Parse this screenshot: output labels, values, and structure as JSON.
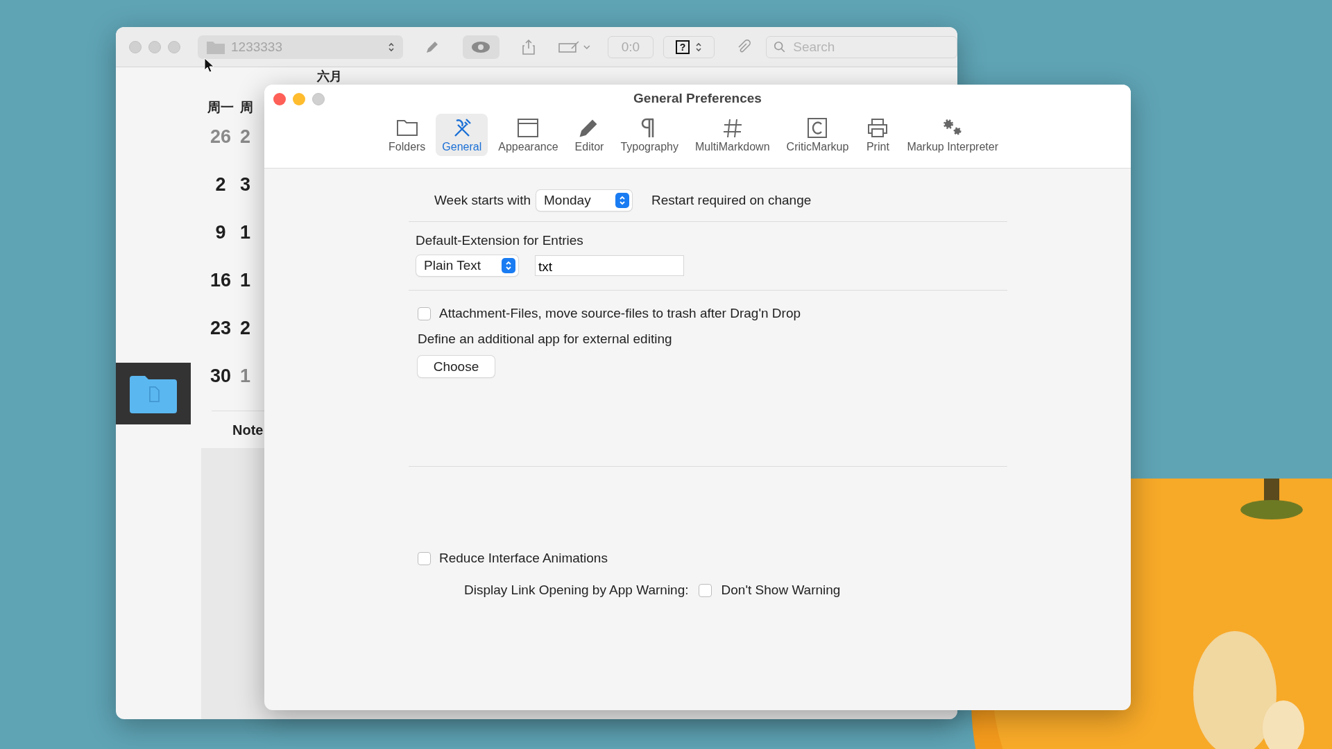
{
  "back_window": {
    "document_popup": "1233333",
    "counter": "0:0",
    "help_popup": "?",
    "search": {
      "placeholder": "Search"
    },
    "calendar": {
      "month": "六月",
      "weekdays": [
        "周一",
        "周"
      ],
      "weeks": [
        [
          {
            "day": "26",
            "other_month": true
          },
          {
            "day": "2",
            "other_month": true
          }
        ],
        [
          {
            "day": "2",
            "other_month": false
          },
          {
            "day": "3",
            "other_month": false
          }
        ],
        [
          {
            "day": "9",
            "other_month": false
          },
          {
            "day": "1",
            "other_month": false
          }
        ],
        [
          {
            "day": "16",
            "other_month": false
          },
          {
            "day": "1",
            "other_month": false
          }
        ],
        [
          {
            "day": "23",
            "other_month": false
          },
          {
            "day": "2",
            "other_month": false
          }
        ],
        [
          {
            "day": "30",
            "other_month": false
          },
          {
            "day": "1",
            "other_month": true
          }
        ]
      ]
    },
    "notes_heading": "Note"
  },
  "preferences": {
    "title": "General Preferences",
    "tabs": [
      {
        "label": "Folders",
        "kind": "folder",
        "selected": false
      },
      {
        "label": "General",
        "kind": "tools",
        "selected": true
      },
      {
        "label": "Appearance",
        "kind": "window",
        "selected": false
      },
      {
        "label": "Editor",
        "kind": "pencil",
        "selected": false
      },
      {
        "label": "Typography",
        "kind": "pilcrow",
        "selected": false
      },
      {
        "label": "MultiMarkdown",
        "kind": "hash",
        "selected": false
      },
      {
        "label": "CriticMarkup",
        "kind": "cbox",
        "selected": false
      },
      {
        "label": "Print",
        "kind": "printer",
        "selected": false
      },
      {
        "label": "Markup Interpreter",
        "kind": "gears",
        "selected": false
      }
    ],
    "week_start": {
      "label": "Week starts with",
      "value": "Monday",
      "note": "Restart required on change"
    },
    "default_extension": {
      "label": "Default-Extension for Entries",
      "format": "Plain Text",
      "extension": "txt"
    },
    "move_attachments": {
      "label": "Attachment-Files, move source-files to trash after Drag'n Drop",
      "checked": false
    },
    "external_editor": {
      "label": "Define an additional app for external editing",
      "button": "Choose"
    },
    "reduce_animations": {
      "label": "Reduce Interface Animations",
      "checked": false
    },
    "link_warning": {
      "label": "Display Link Opening by App Warning:",
      "option_label": "Don't Show Warning",
      "checked": false
    }
  }
}
